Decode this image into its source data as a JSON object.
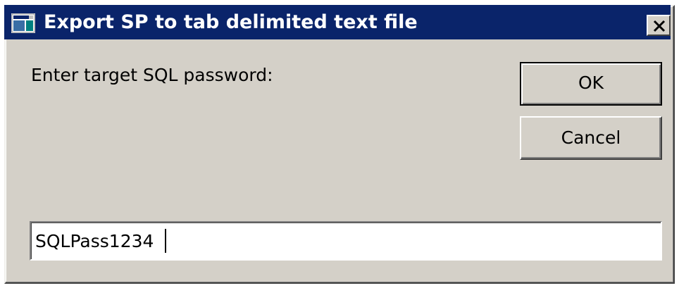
{
  "window": {
    "title": "Export SP to tab delimited text file",
    "close_glyph": "close-icon",
    "app_icon": "app-window-icon",
    "colors": {
      "titlebar": "#0a246a",
      "face": "#d4d0c8"
    }
  },
  "prompt": {
    "label": "Enter target SQL password:"
  },
  "buttons": {
    "ok_label": "OK",
    "cancel_label": "Cancel"
  },
  "password_field": {
    "value": "SQLPass1234"
  }
}
